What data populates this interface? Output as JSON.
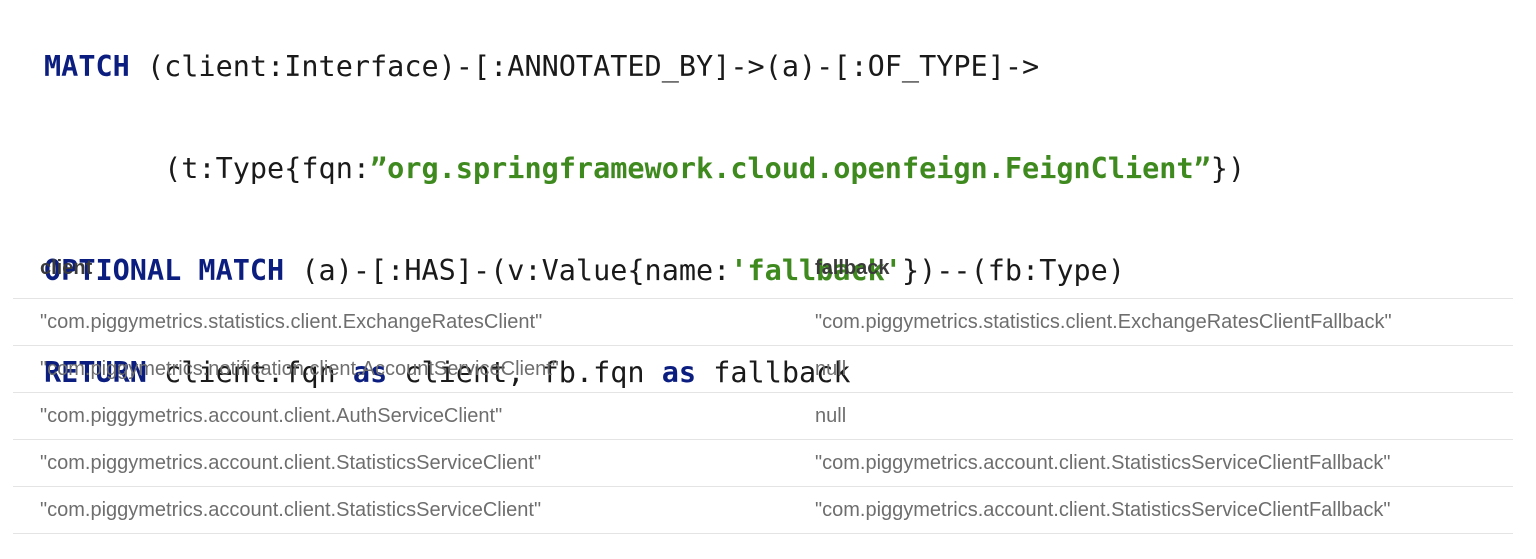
{
  "query": {
    "lines": [
      [
        {
          "t": "MATCH",
          "k": "kw"
        },
        {
          "t": " (client:Interface)-[:ANNOTATED_BY]->(a)-[:OF_TYPE]->",
          "k": "plain"
        }
      ],
      [
        {
          "t": "       (t:Type{fqn:",
          "k": "plain"
        },
        {
          "t": "”org.springframework.cloud.openfeign.FeignClient”",
          "k": "str"
        },
        {
          "t": "})",
          "k": "plain"
        }
      ],
      [
        {
          "t": "OPTIONAL MATCH",
          "k": "kw"
        },
        {
          "t": " (a)-[:HAS]-(v:Value{name:",
          "k": "plain"
        },
        {
          "t": "'fallback'",
          "k": "str"
        },
        {
          "t": "})--(fb:Type)",
          "k": "plain"
        }
      ],
      [
        {
          "t": "RETURN",
          "k": "kw"
        },
        {
          "t": " client.fqn ",
          "k": "plain"
        },
        {
          "t": "as",
          "k": "kw"
        },
        {
          "t": " client, fb.fqn ",
          "k": "plain"
        },
        {
          "t": "as",
          "k": "kw"
        },
        {
          "t": " fallback",
          "k": "plain"
        }
      ]
    ]
  },
  "colors": {
    "keyword": "#0b1e80",
    "string": "#3f8a1f",
    "text": "#1a1a1a",
    "header": "#3a3a3a",
    "cell": "#6e6e6e",
    "divider": "#e4e4e4"
  },
  "results": {
    "columns": [
      "client",
      "fallback"
    ],
    "rows": [
      [
        "\"com.piggymetrics.statistics.client.ExchangeRatesClient\"",
        "\"com.piggymetrics.statistics.client.ExchangeRatesClientFallback\""
      ],
      [
        "\"com.piggymetrics.notification.client.AccountServiceClient\"",
        "null"
      ],
      [
        "\"com.piggymetrics.account.client.AuthServiceClient\"",
        "null"
      ],
      [
        "\"com.piggymetrics.account.client.StatisticsServiceClient\"",
        "\"com.piggymetrics.account.client.StatisticsServiceClientFallback\""
      ],
      [
        "\"com.piggymetrics.account.client.StatisticsServiceClient\"",
        "\"com.piggymetrics.account.client.StatisticsServiceClientFallback\""
      ]
    ]
  }
}
